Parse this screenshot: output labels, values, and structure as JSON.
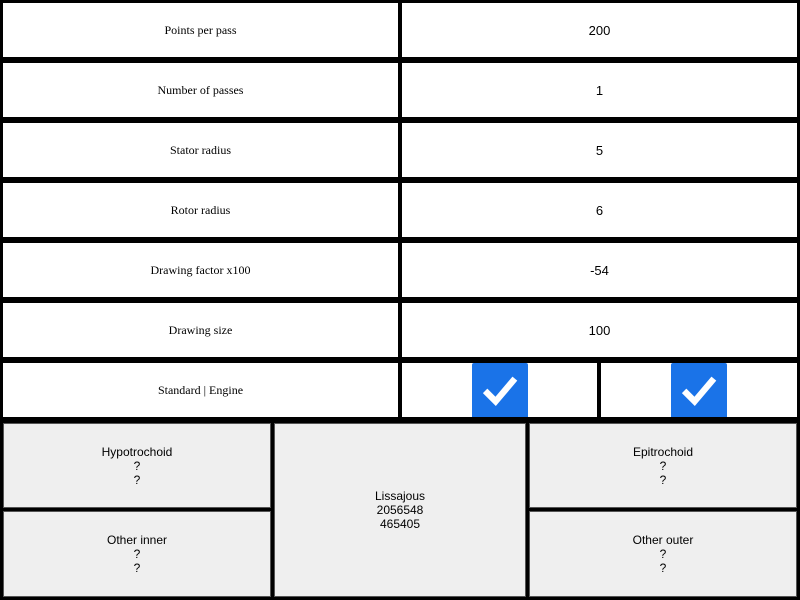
{
  "settings": {
    "points_per_pass": {
      "label": "Points per pass",
      "value": "200"
    },
    "number_of_passes": {
      "label": "Number of passes",
      "value": "1"
    },
    "stator_radius": {
      "label": "Stator radius",
      "value": "5"
    },
    "rotor_radius": {
      "label": "Rotor radius",
      "value": "6"
    },
    "drawing_factor": {
      "label": "Drawing factor x100",
      "value": "-54"
    },
    "drawing_size": {
      "label": "Drawing size",
      "value": "100"
    },
    "mode": {
      "label": "Standard | Engine",
      "standard_checked": true,
      "engine_checked": true
    }
  },
  "curves": {
    "hypotrochoid": {
      "name": "Hypotrochoid",
      "line1": "?",
      "line2": "?"
    },
    "other_inner": {
      "name": "Other inner",
      "line1": "?",
      "line2": "?"
    },
    "lissajous": {
      "name": "Lissajous",
      "line1": "2056548",
      "line2": "465405"
    },
    "epitrochoid": {
      "name": "Epitrochoid",
      "line1": "?",
      "line2": "?"
    },
    "other_outer": {
      "name": "Other outer",
      "line1": "?",
      "line2": "?"
    }
  },
  "colors": {
    "checkbox": "#1a73e8",
    "tile_bg": "#efefef",
    "grid_line": "#000000"
  },
  "icons": {
    "checkbox": "checkmark-icon"
  }
}
